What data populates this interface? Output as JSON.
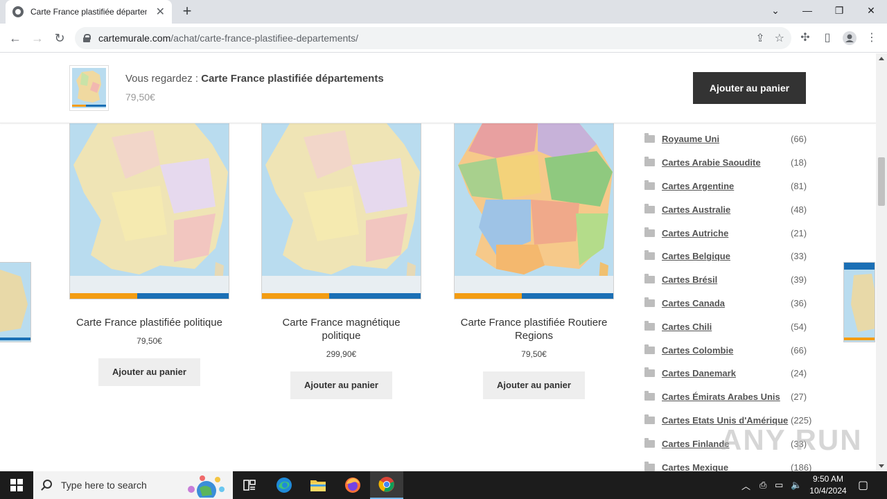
{
  "browser": {
    "tab_title": "Carte France plastifiée départem",
    "url_domain": "cartemurale.com",
    "url_path": "/achat/carte-france-plastifiee-departements/"
  },
  "sticky": {
    "prefix": "Vous regardez : ",
    "product_name": "Carte France plastifiée départements",
    "price": "79,50€",
    "button": "Ajouter au panier"
  },
  "products": [
    {
      "name": "Carte France plastifiée politique",
      "price": "79,50€",
      "button": "Ajouter au panier"
    },
    {
      "name": "Carte France magnétique politique",
      "price": "299,90€",
      "button": "Ajouter au panier"
    },
    {
      "name": "Carte France plastifiée Routiere Regions",
      "price": "79,50€",
      "button": "Ajouter au panier"
    }
  ],
  "categories": [
    {
      "name": "Royaume Uni",
      "count": "(66)"
    },
    {
      "name": "Cartes Arabie Saoudite",
      "count": "(18)"
    },
    {
      "name": "Cartes Argentine",
      "count": "(81)"
    },
    {
      "name": "Cartes Australie",
      "count": "(48)"
    },
    {
      "name": "Cartes Autriche",
      "count": "(21)"
    },
    {
      "name": "Cartes Belgique",
      "count": "(33)"
    },
    {
      "name": "Cartes Brésil",
      "count": "(39)"
    },
    {
      "name": "Cartes Canada",
      "count": "(36)"
    },
    {
      "name": "Cartes Chili",
      "count": "(54)"
    },
    {
      "name": "Cartes Colombie",
      "count": "(66)"
    },
    {
      "name": "Cartes Danemark",
      "count": "(24)"
    },
    {
      "name": "Cartes Émirats Arabes Unis",
      "count": "(27)"
    },
    {
      "name": "Cartes Etats Unis d'Amérique",
      "count": "(225)"
    },
    {
      "name": "Cartes Finlande",
      "count": "(33)"
    },
    {
      "name": "Cartes Mexique",
      "count": "(186)"
    }
  ],
  "watermark": "ANY RUN",
  "taskbar": {
    "search_placeholder": "Type here to search",
    "time": "9:50 AM",
    "date": "10/4/2024"
  },
  "colors": {
    "sticky_button": "#333333",
    "product_button": "#eeeeee",
    "map_sea": "#b9dcef",
    "map_land": "#efe4b5",
    "map_accent_bar": "#f39c12"
  }
}
